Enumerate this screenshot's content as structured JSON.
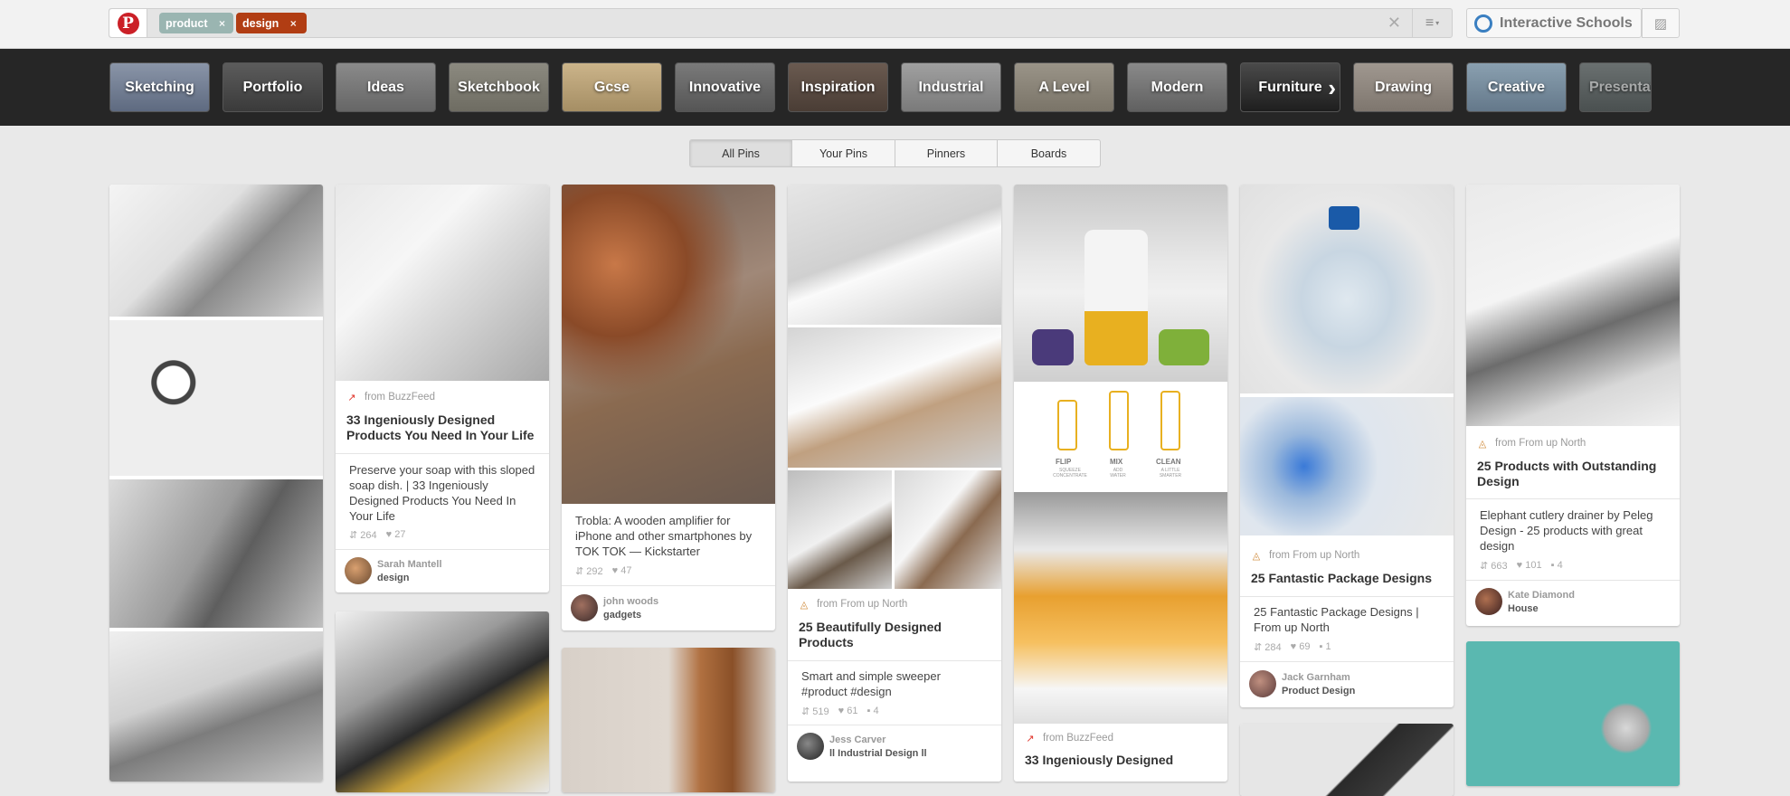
{
  "header": {
    "tokens": [
      "product",
      "design"
    ],
    "token_remove": "×",
    "clear": "✕",
    "menu": "≡",
    "school_name": "Interactive Schools",
    "logo": "P"
  },
  "categories": [
    "Sketching",
    "Portfolio",
    "Ideas",
    "Sketchbook",
    "Gcse",
    "Innovative",
    "Inspiration",
    "Industrial",
    "A Level",
    "Modern",
    "Furniture",
    "Drawing",
    "Creative",
    "Presentation"
  ],
  "tabs": [
    "All Pins",
    "Your Pins",
    "Pinners",
    "Boards"
  ],
  "pins": {
    "c2p1": {
      "source": "from BuzzFeed",
      "title": "33 Ingeniously Designed Products You Need In Your Life",
      "desc": "Preserve your soap with this sloped soap dish. | 33 Ingeniously Designed Products You Need In Your Life",
      "repins": "264",
      "likes": "27",
      "pinner": "Sarah Mantell",
      "board": "design"
    },
    "c3p1": {
      "desc": "Trobla: A wooden amplifier for iPhone and other smartphones by TOK TOK — Kickstarter",
      "repins": "292",
      "likes": "47",
      "pinner": "john woods",
      "board": "gadgets"
    },
    "c4p1": {
      "source": "from From up North",
      "title": "25 Beautifully Designed Products",
      "desc": "Smart and simple sweeper #product #design",
      "repins": "519",
      "likes": "61",
      "comments": "4",
      "pinner": "Jess Carver",
      "board": "ll Industrial Design ll"
    },
    "c5p1": {
      "source": "from BuzzFeed",
      "title": "33 Ingeniously Designed",
      "label_flip": "FLIP",
      "label_mix": "MIX",
      "label_clean": "CLEAN",
      "sub_flip": "SQUEEZE CONCENTRATE",
      "sub_mix": "ADD WATER",
      "sub_clean": "A LITTLE SMARTER"
    },
    "c6p1": {
      "source": "from From up North",
      "title": "25 Fantastic Package Designs",
      "desc": "25 Fantastic Package Designs | From up North",
      "repins": "284",
      "likes": "69",
      "comments": "1",
      "pinner": "Jack Garnham",
      "board": "Product Design"
    },
    "c7p1": {
      "source": "from From up North",
      "title": "25 Products with Outstanding Design",
      "desc": "Elephant cutlery drainer by Peleg Design - 25 products with great design",
      "repins": "663",
      "likes": "101",
      "comments": "4",
      "pinner": "Kate Diamond",
      "board": "House"
    }
  },
  "icons": {
    "repin": "⇵",
    "like": "♥",
    "comment": "▪",
    "buzzfeed": "↗",
    "fromupnorth": "◬"
  },
  "colors": {
    "pinterest_red": "#cb2027",
    "token_product": "#9ab5b1",
    "token_design": "#b13d13",
    "category_bar": "#262626"
  }
}
